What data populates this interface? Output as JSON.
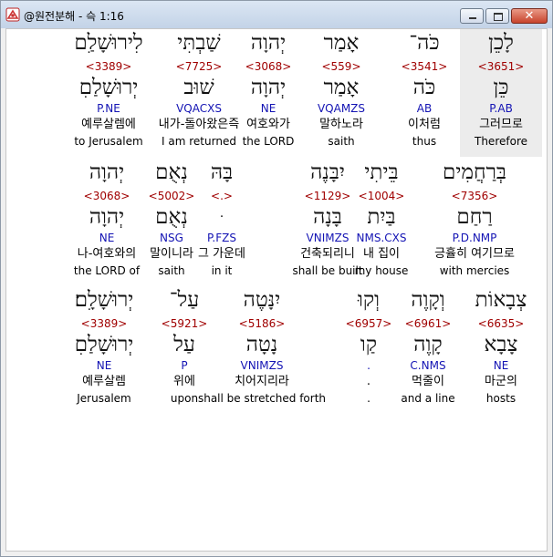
{
  "window": {
    "title": "@원전분해 - 슥 1:16",
    "buttons": {
      "minimize": "minimize",
      "maximize": "maximize",
      "close": "✕"
    }
  },
  "rows": [
    {
      "words": [
        {
          "hebrew": "לָכֵן",
          "strong": "<3651>",
          "lemma": "כֵּן",
          "morph": "P.AB",
          "korean": "그러므로",
          "english": "Therefore",
          "selected": true
        },
        {
          "hebrew": "כֹּה־",
          "strong": "<3541>",
          "lemma": "כֹּה",
          "morph": "AB",
          "korean": "이처럼",
          "english": "thus"
        },
        {
          "hebrew": "אָמַר",
          "strong": "<559>",
          "lemma": "אָמַר",
          "morph": "VQAMZS",
          "korean": "말하노라",
          "english": "saith"
        },
        {
          "hebrew": "יְהוָה",
          "strong": "<3068>",
          "lemma": "יְהוָה",
          "morph": "NE",
          "korean": "여호와가",
          "english": "the LORD"
        },
        {
          "hebrew": "שַׁבְתִּי",
          "strong": "<7725>",
          "lemma": "שׁוּב",
          "morph": "VQACXS",
          "korean": "내가-돌아왔은즉",
          "english": "I am returned"
        },
        {
          "hebrew": "לִירוּשָׁלִַם",
          "strong": "<3389>",
          "lemma": "יְרוּשָׁלַםִ",
          "morph": "P.NE",
          "korean": "예루살렘에",
          "english": "to Jerusalem"
        }
      ]
    },
    {
      "words": [
        {
          "hebrew": "בְּרַחֲמִים",
          "strong": "<7356>",
          "lemma": "רַחַם",
          "morph": "P.D.NMP",
          "korean": "긍휼히 여기므로",
          "english": "with mercies"
        },
        {
          "hebrew": "בֵּיתִי",
          "strong": "<1004>",
          "lemma": "בַּיִת",
          "morph": "NMS.CXS",
          "korean": "내 집이",
          "english": "my house"
        },
        {
          "hebrew": "יִבָּנֶה",
          "strong": "<1129>",
          "lemma": "בָּנָה",
          "morph": "VNIMZS",
          "korean": "건축되리니",
          "english": "shall be built"
        },
        {
          "hebrew": "בָּהּ",
          "strong": "<.>",
          "lemma": "ּ",
          "morph": "P.FZS",
          "korean": "그 가운데",
          "english": "in it"
        },
        {
          "hebrew": "נְאֻם",
          "strong": "<5002>",
          "lemma": "נְאֻם",
          "morph": "NSG",
          "korean": "말이니라",
          "english": "saith"
        },
        {
          "hebrew": "יְהוָה",
          "strong": "<3068>",
          "lemma": "יְהוָה",
          "morph": "NE",
          "korean": "나-여호와의",
          "english": "the LORD of"
        }
      ]
    },
    {
      "words": [
        {
          "hebrew": "צְבָאוֹת",
          "strong": "<6635>",
          "lemma": "צָבָא",
          "morph": "NE",
          "korean": "마군의",
          "english": "hosts"
        },
        {
          "hebrew": "וְקָוֶה",
          "strong": "<6961>",
          "lemma": "קָוֶה",
          "morph": "C.NMS",
          "korean": "먹줄이",
          "english": "and a line"
        },
        {
          "hebrew": "וְקוּ",
          "strong": "<6957>",
          "lemma": "קַו",
          "morph": ".",
          "korean": ".",
          "english": "."
        },
        {
          "hebrew": "יִנָּטֶה",
          "strong": "<5186>",
          "lemma": "נָטָה",
          "morph": "VNIMZS",
          "korean": "치어지리라",
          "english": "shall be stretched forth"
        },
        {
          "hebrew": "עַל־",
          "strong": "<5921>",
          "lemma": "עַל",
          "morph": "P",
          "korean": "위에",
          "english": "upon"
        },
        {
          "hebrew": "יְרוּשָׁלִָם׃",
          "strong": "<3389>",
          "lemma": "יְרוּשָׁלַםִ",
          "morph": "NE",
          "korean": "예루살렘",
          "english": "Jerusalem"
        }
      ]
    }
  ]
}
